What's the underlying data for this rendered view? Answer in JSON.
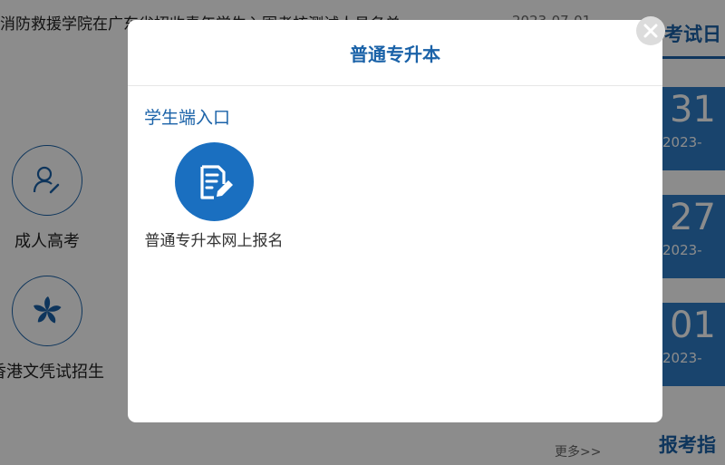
{
  "background": {
    "news_title": "消防救援学院在广东省招收青年学生入围考核测试人员名单",
    "news_date": "2023-07-01",
    "right_tab_label": "考试日",
    "dates": [
      {
        "day": "31",
        "ym": "2023-"
      },
      {
        "day": "27",
        "ym": "2023-"
      },
      {
        "day": "01",
        "ym": "2023-"
      }
    ],
    "services": [
      {
        "label": "成人高考",
        "icon": "user-edit-icon"
      },
      {
        "label": "香港文凭试招生",
        "icon": "bauhinia-icon"
      }
    ],
    "more_link": "更多>>",
    "bottom_title": "报考指"
  },
  "modal": {
    "title": "普通专升本",
    "section_title": "学生端入口",
    "entry_label": "普通专升本网上报名",
    "entry_icon": "edit-document-icon",
    "close_icon": "close-icon"
  },
  "colors": {
    "accent": "#1a62a8",
    "entry_circle": "#1a6fc0",
    "date_box": "#2e7dc6",
    "overlay": "rgba(0,0,0,0.45)"
  }
}
